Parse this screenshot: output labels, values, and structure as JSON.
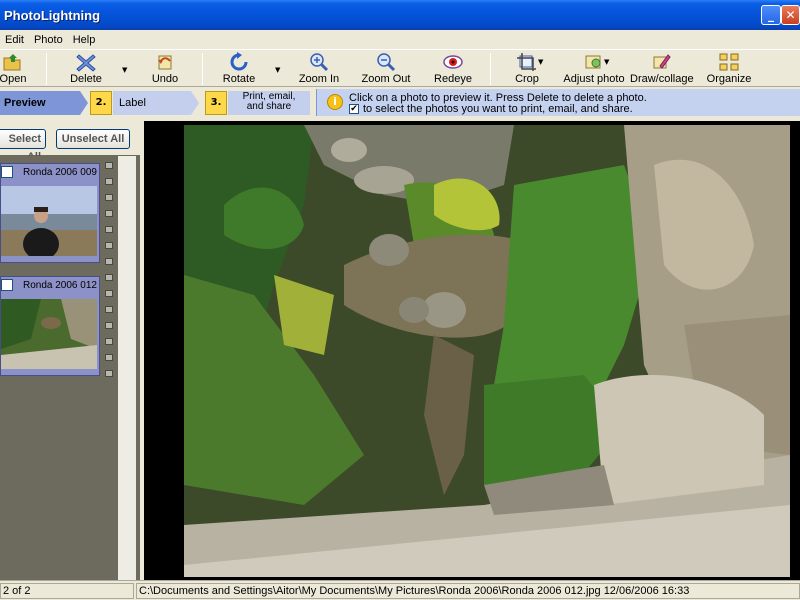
{
  "window": {
    "title": "PhotoLightning",
    "minimize": "_",
    "maximize": "□",
    "close": "✕"
  },
  "menu": [
    "Edit",
    "Photo",
    "Help"
  ],
  "toolbar": {
    "open": "Open",
    "delete": "Delete",
    "undo": "Undo",
    "rotate": "Rotate",
    "zoom_in": "Zoom In",
    "zoom_out": "Zoom Out",
    "redeye": "Redeye",
    "crop": "Crop",
    "adjust_photo": "Adjust photo",
    "draw_collage": "Draw/collage",
    "organize": "Organize",
    "dropdown_glyph": "▼"
  },
  "steps": {
    "step1_label": "Preview",
    "step2_number": "2.",
    "step2_label": "Label",
    "step3_number": "3.",
    "step3_line1": "Print, email,",
    "step3_line2": "and share"
  },
  "hint": {
    "icon": "i",
    "line1": "Click on a photo to preview it.  Press Delete to delete a photo.",
    "check": "✔",
    "line2": "to select the photos you want to print, email, and share."
  },
  "select": {
    "select_all": "Select All",
    "unselect_all": "Unselect All"
  },
  "thumbnails": [
    {
      "caption": "Ronda 2006 009"
    },
    {
      "caption": "Ronda 2006 012"
    }
  ],
  "status": {
    "count": "2 of 2",
    "path": "C:\\Documents and Settings\\Aitor\\My Documents\\My Pictures\\Ronda 2006\\Ronda 2006 012.jpg   12/06/2006 16:33"
  },
  "colors": {
    "title_bar": "#0553d9",
    "step_active": "#7e96d8",
    "step_number": "#ffd84a",
    "hint_bg": "#c4d2f0",
    "panel_bg": "#6d6b5d"
  }
}
